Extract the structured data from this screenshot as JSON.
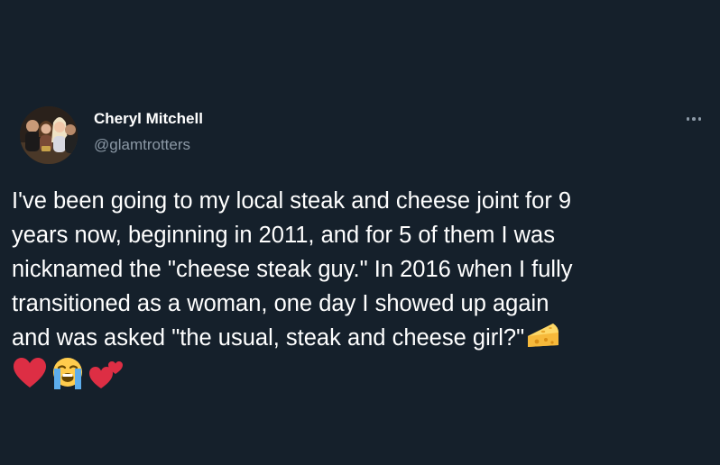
{
  "tweet": {
    "author_name": "Cheryl Mitchell",
    "author_handle": "@glamtrotters",
    "more_icon": "more-dots-icon",
    "text_lines": [
      "I've been going to my local steak and cheese joint for 9",
      "years now, beginning in 2011, and for 5 of them I was",
      "nicknamed the \"cheese steak guy.\" In 2016 when I fully",
      "transitioned as a woman, one day I showed up again",
      "and was asked \"the usual, steak and cheese girl?\""
    ],
    "emojis": [
      "cheese-wedge-emoji",
      "red-heart-emoji",
      "loudly-crying-face-emoji",
      "two-hearts-emoji"
    ]
  },
  "colors": {
    "background": "#15202b",
    "primary_text": "#ffffff",
    "secondary_text": "#8b98a5",
    "heart_red": "#dd2e44",
    "cheese_yellow": "#fdcb58"
  }
}
